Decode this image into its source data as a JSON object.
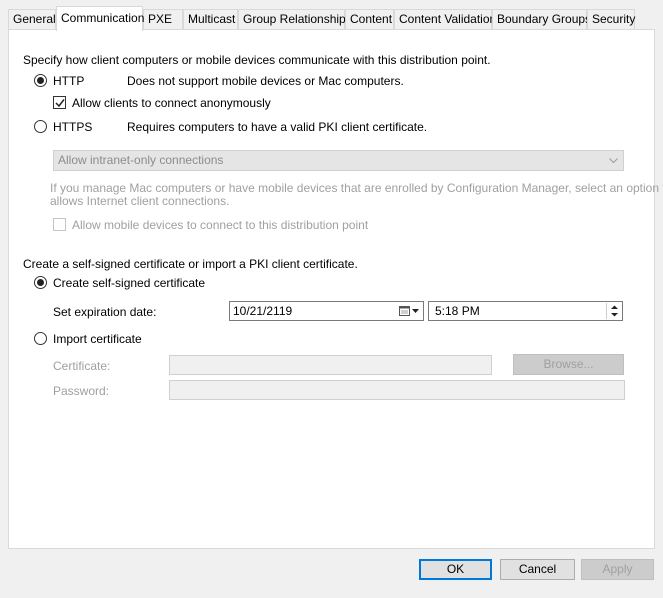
{
  "tabs": [
    {
      "label": "General",
      "active": false
    },
    {
      "label": "Communication",
      "active": true
    },
    {
      "label": "PXE",
      "active": false
    },
    {
      "label": "Multicast",
      "active": false
    },
    {
      "label": "Group Relationships",
      "active": false
    },
    {
      "label": "Content",
      "active": false
    },
    {
      "label": "Content Validation",
      "active": false
    },
    {
      "label": "Boundary Groups",
      "active": false
    },
    {
      "label": "Security",
      "active": false
    }
  ],
  "communication": {
    "intro": "Specify how client computers or mobile devices communicate with this distribution point.",
    "http_label": "HTTP",
    "http_desc": "Does not support mobile devices or Mac computers.",
    "http_selected": true,
    "anonymous_label": "Allow clients to connect anonymously",
    "anonymous_checked": true,
    "https_label": "HTTPS",
    "https_desc": "Requires computers to have a valid PKI client certificate.",
    "https_selected": false,
    "intranet_combo_value": "Allow intranet-only connections",
    "mac_note_line1": "If you manage Mac computers or have mobile devices that are enrolled by Configuration Manager, select an option that",
    "mac_note_line2": "allows Internet client connections.",
    "mobile_label": "Allow mobile devices to connect to this distribution point",
    "mobile_checked": false
  },
  "certificate": {
    "intro": "Create a self-signed certificate or import a PKI client certificate.",
    "self_signed_label": "Create self-signed certificate",
    "self_signed_selected": true,
    "expiration_label": "Set expiration date:",
    "expiration_date": "10/21/2119",
    "expiration_time": "5:18 PM",
    "import_label": "Import certificate",
    "import_selected": false,
    "certificate_label": "Certificate:",
    "certificate_value": "",
    "browse_label": "Browse...",
    "password_label": "Password:",
    "password_value": ""
  },
  "footer": {
    "ok_label": "OK",
    "cancel_label": "Cancel",
    "apply_label": "Apply"
  }
}
